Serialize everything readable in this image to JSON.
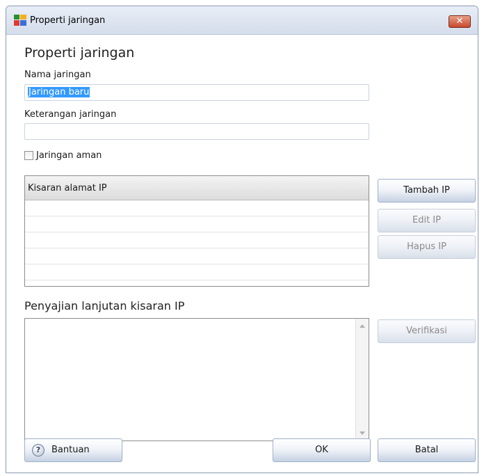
{
  "window": {
    "title": "Properti jaringan"
  },
  "heading": "Properti jaringan",
  "network_name": {
    "label": "Nama jaringan",
    "value": "Jaringan baru"
  },
  "network_description": {
    "label": "Keterangan jaringan",
    "value": ""
  },
  "secure_network": {
    "label": "Jaringan aman",
    "checked": false
  },
  "ip_table": {
    "header": "Kisaran alamat IP",
    "rows": []
  },
  "ip_buttons": {
    "add": "Tambah IP",
    "edit": "Edit IP",
    "remove": "Hapus IP"
  },
  "advanced": {
    "heading": "Penyajian lanjutan kisaran IP",
    "value": "",
    "verify": "Verifikasi"
  },
  "footer": {
    "help": "Bantuan",
    "ok": "OK",
    "cancel": "Batal"
  },
  "icons": {
    "app": "avg-logo-icon",
    "close": "close-icon",
    "help": "help-icon"
  }
}
